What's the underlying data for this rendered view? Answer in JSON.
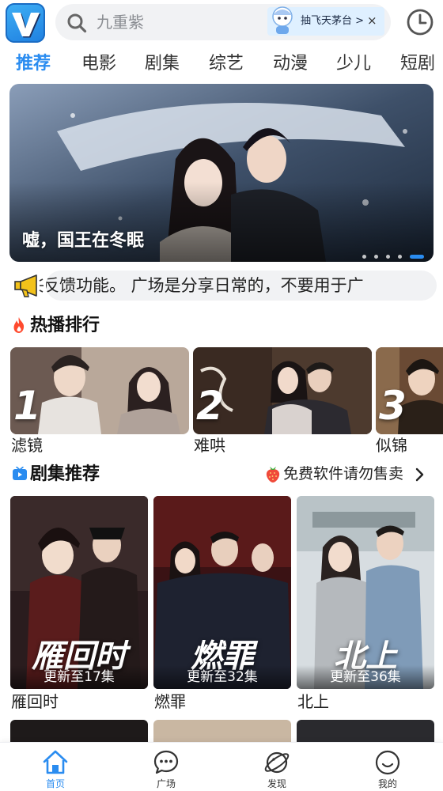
{
  "header": {
    "search_placeholder": "九重紫",
    "promo_label": "抽飞天茅台 >",
    "promo_close": "×"
  },
  "tabs": [
    {
      "label": "推荐",
      "active": true
    },
    {
      "label": "电影"
    },
    {
      "label": "剧集"
    },
    {
      "label": "综艺"
    },
    {
      "label": "动漫"
    },
    {
      "label": "少儿"
    },
    {
      "label": "短剧"
    }
  ],
  "banner": {
    "title": "嘘，国王在冬眠",
    "slide_count": 5,
    "active_slide": 5
  },
  "notice": {
    "text": "反馈功能。    广场是分享日常的，不要用于广"
  },
  "hot": {
    "title": "热播排行",
    "items": [
      {
        "rank": "1",
        "name": "滤镜"
      },
      {
        "rank": "2",
        "name": "难哄"
      },
      {
        "rank": "3",
        "name": "似锦"
      }
    ]
  },
  "drama": {
    "title": "剧集推荐",
    "note": "免费软件请勿售卖",
    "items": [
      {
        "name": "雁回时",
        "art": "雁回时",
        "update": "更新至17集"
      },
      {
        "name": "燃罪",
        "art": "燃罪",
        "update": "更新至32集"
      },
      {
        "name": "北上",
        "art": "北上",
        "update": "更新至36集"
      }
    ]
  },
  "bottom_nav": [
    {
      "label": "首页",
      "icon": "home-icon",
      "active": true
    },
    {
      "label": "广场",
      "icon": "chat-bubble-icon"
    },
    {
      "label": "发现",
      "icon": "planet-icon"
    },
    {
      "label": "我的",
      "icon": "smiley-icon"
    }
  ],
  "colors": {
    "accent": "#2a8cf0",
    "search_bg": "#f1f2f4",
    "promo_bg": "#dff0ff"
  }
}
